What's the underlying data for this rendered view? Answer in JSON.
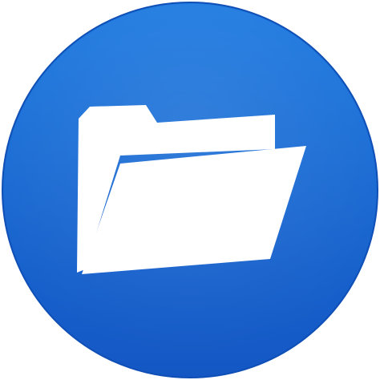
{
  "icon": {
    "name": "folder-icon",
    "shape": "circle",
    "colors": {
      "circle_top": "#1f7be0",
      "circle_bottom": "#1457c4",
      "circle_edge": "#0f4fb6",
      "folder": "#ffffff"
    }
  }
}
